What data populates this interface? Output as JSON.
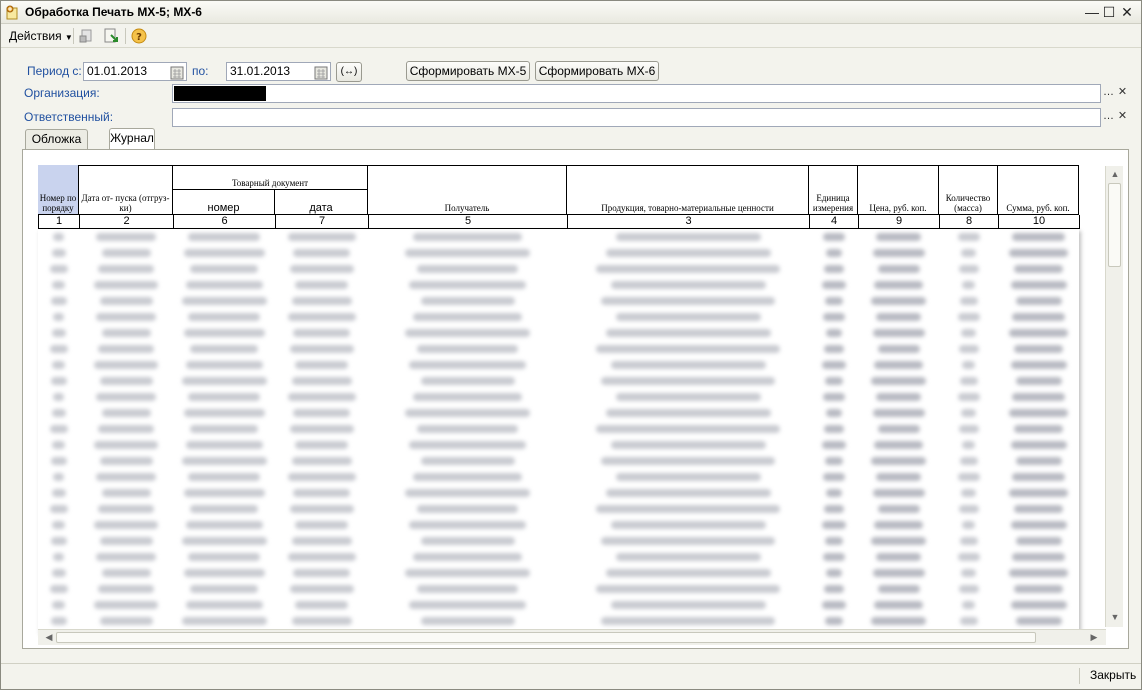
{
  "window": {
    "title": "Обработка  Печать МХ-5; МХ-6"
  },
  "toolbar": {
    "actions_label": "Действия"
  },
  "form": {
    "period_from_label": "Период с:",
    "period_from_value": "01.01.2013",
    "period_to_label": "по:",
    "period_to_value": "31.01.2013",
    "period_select_glyph": "(↔)",
    "btn_mx5": "Сформировать МХ-5",
    "btn_mx6": "Сформировать МХ-6",
    "org_label": "Организация:",
    "org_value": "",
    "resp_label": "Ответственный:",
    "resp_value": ""
  },
  "tabs": [
    {
      "label": "Обложка",
      "active": false
    },
    {
      "label": "Журнал",
      "active": true
    }
  ],
  "table": {
    "headers": {
      "col1": "Номер по порядку",
      "col2": "Дата от- пуска (отгруз- ки)",
      "group_doc": "Товарный документ",
      "col6": "номер",
      "col7": "дата",
      "col5": "Получатель",
      "col3": "Продукция, товарно-материальные ценности",
      "col4": "Единица измерения",
      "col9": "Цена, руб. коп.",
      "col8": "Количество (масса)",
      "col10": "Сумма, руб. коп."
    },
    "col_numbers": [
      "1",
      "2",
      "6",
      "7",
      "5",
      "3",
      "4",
      "9",
      "8",
      "10"
    ],
    "visible_rows": 25
  },
  "footer": {
    "close_label": "Закрыть"
  },
  "colors": {
    "label_blue": "#2050a0",
    "window_bg": "#f3f3ed"
  }
}
